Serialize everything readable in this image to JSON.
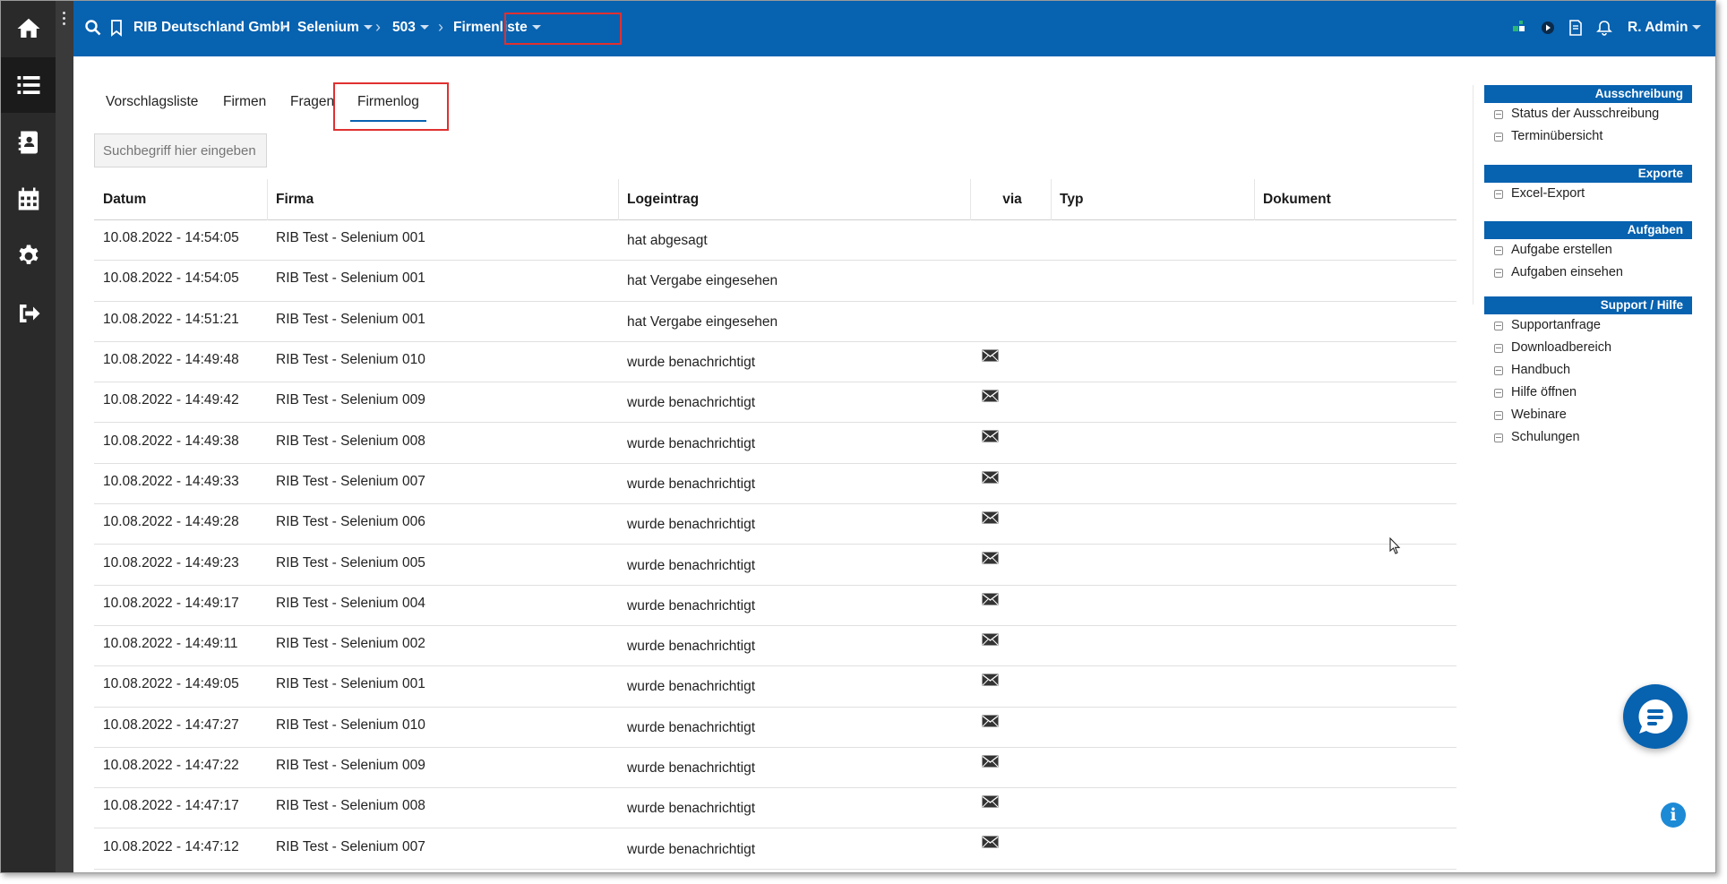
{
  "left_nav": [
    {
      "icon": "home-icon"
    },
    {
      "icon": "list-icon"
    },
    {
      "icon": "contacts-icon"
    },
    {
      "icon": "calendar-icon"
    },
    {
      "icon": "gear-icon"
    },
    {
      "icon": "logout-icon"
    }
  ],
  "breadcrumb": {
    "company": "RIB Deutschland GmbH",
    "project": "Selenium",
    "number": "503",
    "page": "Firmenliste"
  },
  "user": {
    "name": "R. Admin"
  },
  "tabs": [
    {
      "label": "Vorschlagsliste",
      "active": false
    },
    {
      "label": "Firmen",
      "active": false
    },
    {
      "label": "Fragen",
      "active": false
    },
    {
      "label": "Firmenlog",
      "active": true
    }
  ],
  "search": {
    "placeholder": "Suchbegriff hier eingeben",
    "value": ""
  },
  "table": {
    "headers": [
      "Datum",
      "Firma",
      "Logeintrag",
      "via",
      "Typ",
      "Dokument"
    ],
    "rows": [
      {
        "date": "10.08.2022 - 14:54:05",
        "firm": "RIB Test - Selenium 001",
        "log": "hat abgesagt",
        "via": ""
      },
      {
        "date": "10.08.2022 - 14:54:05",
        "firm": "RIB Test - Selenium 001",
        "log": "hat Vergabe eingesehen",
        "via": ""
      },
      {
        "date": "10.08.2022 - 14:51:21",
        "firm": "RIB Test - Selenium 001",
        "log": "hat Vergabe eingesehen",
        "via": ""
      },
      {
        "date": "10.08.2022 - 14:49:48",
        "firm": "RIB Test - Selenium 010",
        "log": "wurde benachrichtigt",
        "via": "mail-icon"
      },
      {
        "date": "10.08.2022 - 14:49:42",
        "firm": "RIB Test - Selenium 009",
        "log": "wurde benachrichtigt",
        "via": "mail-icon"
      },
      {
        "date": "10.08.2022 - 14:49:38",
        "firm": "RIB Test - Selenium 008",
        "log": "wurde benachrichtigt",
        "via": "mail-icon"
      },
      {
        "date": "10.08.2022 - 14:49:33",
        "firm": "RIB Test - Selenium 007",
        "log": "wurde benachrichtigt",
        "via": "mail-icon"
      },
      {
        "date": "10.08.2022 - 14:49:28",
        "firm": "RIB Test - Selenium 006",
        "log": "wurde benachrichtigt",
        "via": "mail-icon"
      },
      {
        "date": "10.08.2022 - 14:49:23",
        "firm": "RIB Test - Selenium 005",
        "log": "wurde benachrichtigt",
        "via": "mail-icon"
      },
      {
        "date": "10.08.2022 - 14:49:17",
        "firm": "RIB Test - Selenium 004",
        "log": "wurde benachrichtigt",
        "via": "mail-icon"
      },
      {
        "date": "10.08.2022 - 14:49:11",
        "firm": "RIB Test - Selenium 002",
        "log": "wurde benachrichtigt",
        "via": "mail-icon"
      },
      {
        "date": "10.08.2022 - 14:49:05",
        "firm": "RIB Test - Selenium 001",
        "log": "wurde benachrichtigt",
        "via": "mail-icon"
      },
      {
        "date": "10.08.2022 - 14:47:27",
        "firm": "RIB Test - Selenium 010",
        "log": "wurde benachrichtigt",
        "via": "mail-icon"
      },
      {
        "date": "10.08.2022 - 14:47:22",
        "firm": "RIB Test - Selenium 009",
        "log": "wurde benachrichtigt",
        "via": "mail-icon"
      },
      {
        "date": "10.08.2022 - 14:47:17",
        "firm": "RIB Test - Selenium 008",
        "log": "wurde benachrichtigt",
        "via": "mail-icon"
      },
      {
        "date": "10.08.2022 - 14:47:12",
        "firm": "RIB Test - Selenium 007",
        "log": "wurde benachrichtigt",
        "via": "mail-icon"
      }
    ]
  },
  "right_panel": [
    {
      "title": "Ausschreibung",
      "items": [
        "Status der Ausschreibung",
        "Terminübersicht"
      ]
    },
    {
      "title": "Exporte",
      "items": [
        "Excel-Export"
      ]
    },
    {
      "title": "Aufgaben",
      "items": [
        "Aufgabe erstellen",
        "Aufgaben einsehen"
      ]
    },
    {
      "title": "Support / Hilfe",
      "items": [
        "Supportanfrage",
        "Downloadbereich",
        "Handbuch",
        "Hilfe öffnen",
        "Webinare",
        "Schulungen"
      ]
    }
  ],
  "colors": {
    "brand_blue": "#0762b0",
    "rail": "#2a2a2a",
    "highlight_red": "#e03030"
  },
  "widgets": {
    "chat_icon": "chat-bubble-icon",
    "info_icon": "info-icon"
  }
}
